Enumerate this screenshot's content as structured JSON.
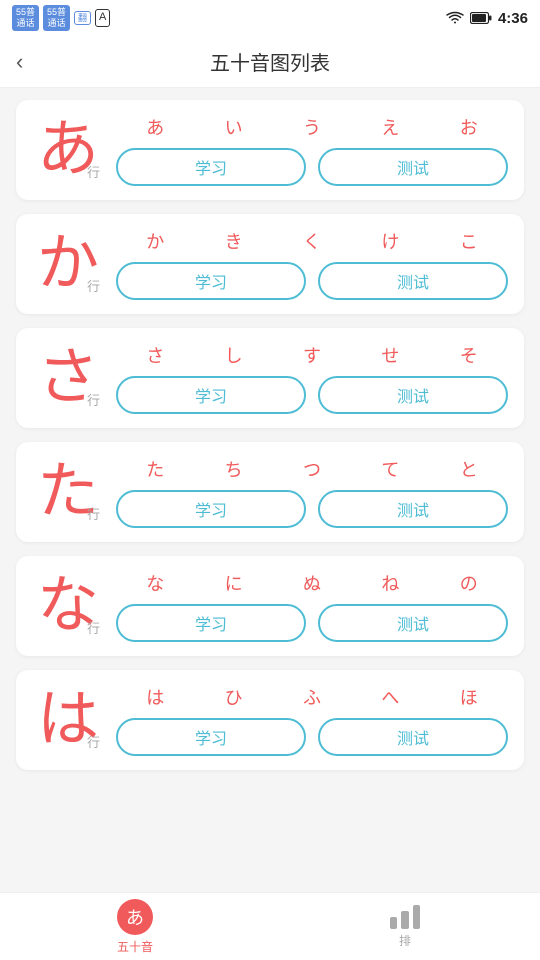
{
  "statusBar": {
    "badges": [
      "55普",
      "55普"
    ],
    "time": "4:36"
  },
  "header": {
    "backLabel": "‹",
    "title": "五十音图列表"
  },
  "rows": [
    {
      "id": "a-row",
      "bigKana": "あ",
      "rowLabel": "行",
      "chars": [
        "あ",
        "い",
        "う",
        "え",
        "お"
      ],
      "studyLabel": "学习",
      "testLabel": "测试"
    },
    {
      "id": "ka-row",
      "bigKana": "か",
      "rowLabel": "行",
      "chars": [
        "か",
        "き",
        "く",
        "け",
        "こ"
      ],
      "studyLabel": "学习",
      "testLabel": "测试"
    },
    {
      "id": "sa-row",
      "bigKana": "さ",
      "rowLabel": "行",
      "chars": [
        "さ",
        "し",
        "す",
        "せ",
        "そ"
      ],
      "studyLabel": "学习",
      "testLabel": "测试"
    },
    {
      "id": "ta-row",
      "bigKana": "た",
      "rowLabel": "行",
      "chars": [
        "た",
        "ち",
        "つ",
        "て",
        "と"
      ],
      "studyLabel": "学习",
      "testLabel": "测试"
    },
    {
      "id": "na-row",
      "bigKana": "な",
      "rowLabel": "行",
      "chars": [
        "な",
        "に",
        "ぬ",
        "ね",
        "の"
      ],
      "studyLabel": "学习",
      "testLabel": "测试"
    },
    {
      "id": "ha-row",
      "bigKana": "は",
      "rowLabel": "行",
      "chars": [
        "は",
        "ひ",
        "ふ",
        "へ",
        "ほ"
      ],
      "studyLabel": "学习",
      "testLabel": "测试"
    }
  ],
  "bottomNav": {
    "item1Label": "五十音",
    "item1Kana": "あ",
    "item2Label": "排",
    "bars": [
      12,
      18,
      24
    ]
  }
}
